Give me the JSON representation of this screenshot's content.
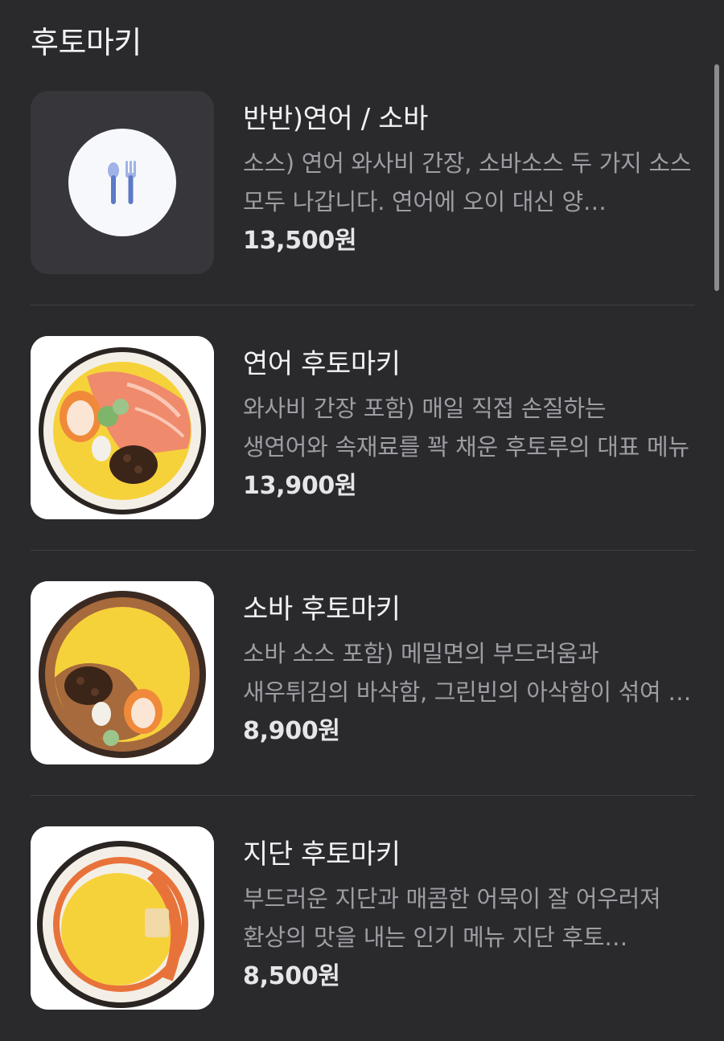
{
  "section": {
    "title": "후토마키"
  },
  "items": [
    {
      "name": "반반)연어 / 소바",
      "description": "소스) 연어 와사비 간장, 소바소스 두 가지 소스 모두 나갑니다. 연어에 오이 대신 양…",
      "price": "13,500원",
      "image_icon": "fork-spoon-icon"
    },
    {
      "name": "연어 후토마키",
      "description": "와사비 간장 포함) 매일 직접 손질하는 생연어와 속재료를 꽉 채운 후토루의 대표 메뉴",
      "price": "13,900원",
      "image": "salmon-futomaki-photo"
    },
    {
      "name": "소바 후토마키",
      "description": "소바 소스 포함) 메밀면의 부드러움과 새우튀김의 바삭함, 그린빈의 아삭함이 섞여 …",
      "price": "8,900원",
      "image": "soba-futomaki-photo"
    },
    {
      "name": "지단 후토마키",
      "description": "부드러운 지단과 매콤한 어묵이 잘 어우러져 환상의 맛을 내는 인기 메뉴 지단 후토…",
      "price": "8,500원",
      "image": "jidan-futomaki-photo"
    }
  ]
}
